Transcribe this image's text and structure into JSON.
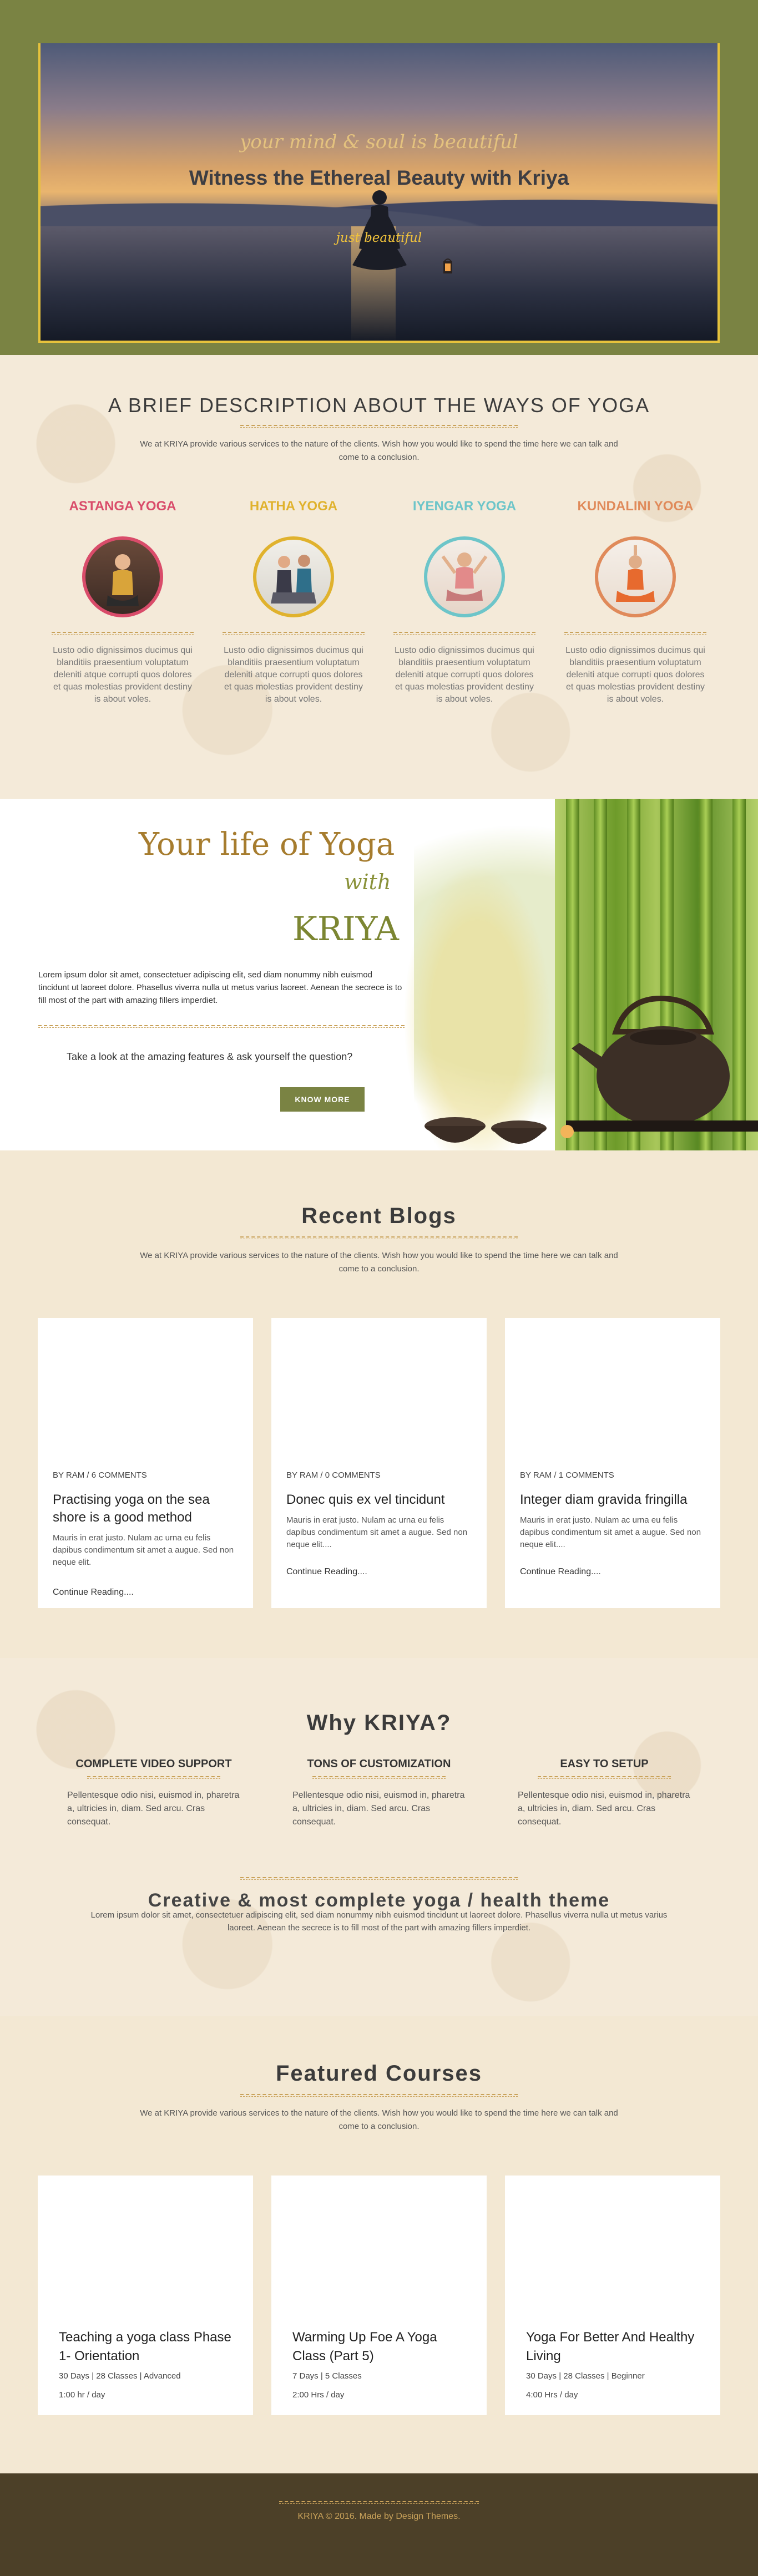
{
  "hero": {
    "tagline_top": "your mind & soul is beautiful",
    "title": "Witness the Ethereal Beauty with Kriya",
    "tagline_bottom": "just beautiful"
  },
  "about": {
    "title": "A BRIEF DESCRIPTION ABOUT THE WAYS OF YOGA",
    "intro": "We at KRIYA provide various services to the nature of the clients. Wish how you would like to spend the time here we can talk and come to a conclusion.",
    "types": [
      {
        "name": "ASTANGA YOGA",
        "color": "#d94c6a",
        "text": "Lusto odio dignissimos ducimus qui blanditiis praesentium voluptatum deleniti atque corrupti quos dolores et quas molestias provident destiny is about voles."
      },
      {
        "name": "HATHA YOGA",
        "color": "#e0b22d",
        "text": "Lusto odio dignissimos ducimus qui blanditiis praesentium voluptatum deleniti atque corrupti quos dolores et quas molestias provident destiny is about voles."
      },
      {
        "name": "IYENGAR YOGA",
        "color": "#6dc5c9",
        "text": "Lusto odio dignissimos ducimus qui blanditiis praesentium voluptatum deleniti atque corrupti quos dolores et quas molestias provident destiny is about voles."
      },
      {
        "name": "KUNDALINI YOGA",
        "color": "#e08a5a",
        "text": "Lusto odio dignissimos ducimus qui blanditiis praesentium voluptatum deleniti atque corrupti quos dolores et quas molestias provident destiny is about voles."
      }
    ]
  },
  "promo": {
    "title": "Your life of Yoga",
    "with": "with",
    "brand": "KRIYA",
    "body": "Lorem ipsum dolor sit amet, consectetuer adipiscing elit, sed diam nonummy nibh euismod tincidunt ut laoreet dolore. Phasellus viverra nulla ut metus varius laoreet. Aenean the secrece is to fill most of the part with amazing fillers imperdiet.",
    "question": "Take a look at the amazing features & ask yourself the question?",
    "button": "KNOW MORE"
  },
  "blogs": {
    "title": "Recent Blogs",
    "intro": "We at KRIYA provide various services to the nature of the clients. Wish how you would like to spend the time here we can talk and come to a conclusion.",
    "posts": [
      {
        "meta": "BY RAM / 6 COMMENTS",
        "title": "Practising yoga on the sea shore is a good method",
        "excerpt": "Mauris in erat justo. Nulam ac urna eu felis dapibus condimentum sit amet a augue. Sed non neque elit.",
        "more": "Continue Reading...."
      },
      {
        "meta": "BY RAM / 0 COMMENTS",
        "title": "Donec quis ex vel tincidunt",
        "excerpt": "Mauris in erat justo. Nulam ac urna eu felis dapibus condimentum sit amet a augue. Sed non neque elit....",
        "more": "Continue Reading...."
      },
      {
        "meta": "BY RAM / 1 COMMENTS",
        "title": "Integer diam gravida fringilla",
        "excerpt": "Mauris in erat justo. Nulam ac urna eu felis dapibus condimentum sit amet a augue. Sed non neque elit....",
        "more": "Continue Reading...."
      }
    ]
  },
  "why": {
    "title": "Why KRIYA?",
    "features": [
      {
        "title": "COMPLETE VIDEO SUPPORT",
        "text": "Pellentesque odio nisi, euismod in, pharetra a, ultricies in, diam. Sed arcu. Cras consequat."
      },
      {
        "title": "TONS OF CUSTOMIZATION",
        "text": "Pellentesque odio nisi, euismod in, pharetra a, ultricies in, diam. Sed arcu. Cras consequat."
      },
      {
        "title": "EASY TO SETUP",
        "text": "Pellentesque odio nisi, euismod in, pharetra a, ultricies in, diam. Sed arcu. Cras consequat."
      }
    ],
    "subtitle": "Creative & most complete yoga / health theme",
    "para": "Lorem ipsum dolor sit amet, consectetuer adipiscing elit, sed diam nonummy nibh euismod tincidunt ut laoreet dolore. Phasellus viverra nulla ut metus varius laoreet. Aenean the secrece is to fill most of the part with amazing fillers imperdiet."
  },
  "courses": {
    "title": "Featured Courses",
    "intro": "We at KRIYA provide various services to the nature of the clients. Wish how you would like to spend the time here we can talk and come to a conclusion.",
    "items": [
      {
        "title": "Teaching a yoga class Phase 1- Orientation",
        "info": "30 Days | 28 Classes | Advanced",
        "time": "1:00 hr / day"
      },
      {
        "title": "Warming Up Foe A Yoga Class (Part 5)",
        "info": "7 Days | 5 Classes",
        "time": "2:00 Hrs / day"
      },
      {
        "title": "Yoga For Better And Healthy Living",
        "info": "30 Days | 28 Classes | Beginner",
        "time": "4:00 Hrs / day"
      }
    ]
  },
  "footer": {
    "text": "KRIYA © 2016. Made by Design Themes."
  }
}
